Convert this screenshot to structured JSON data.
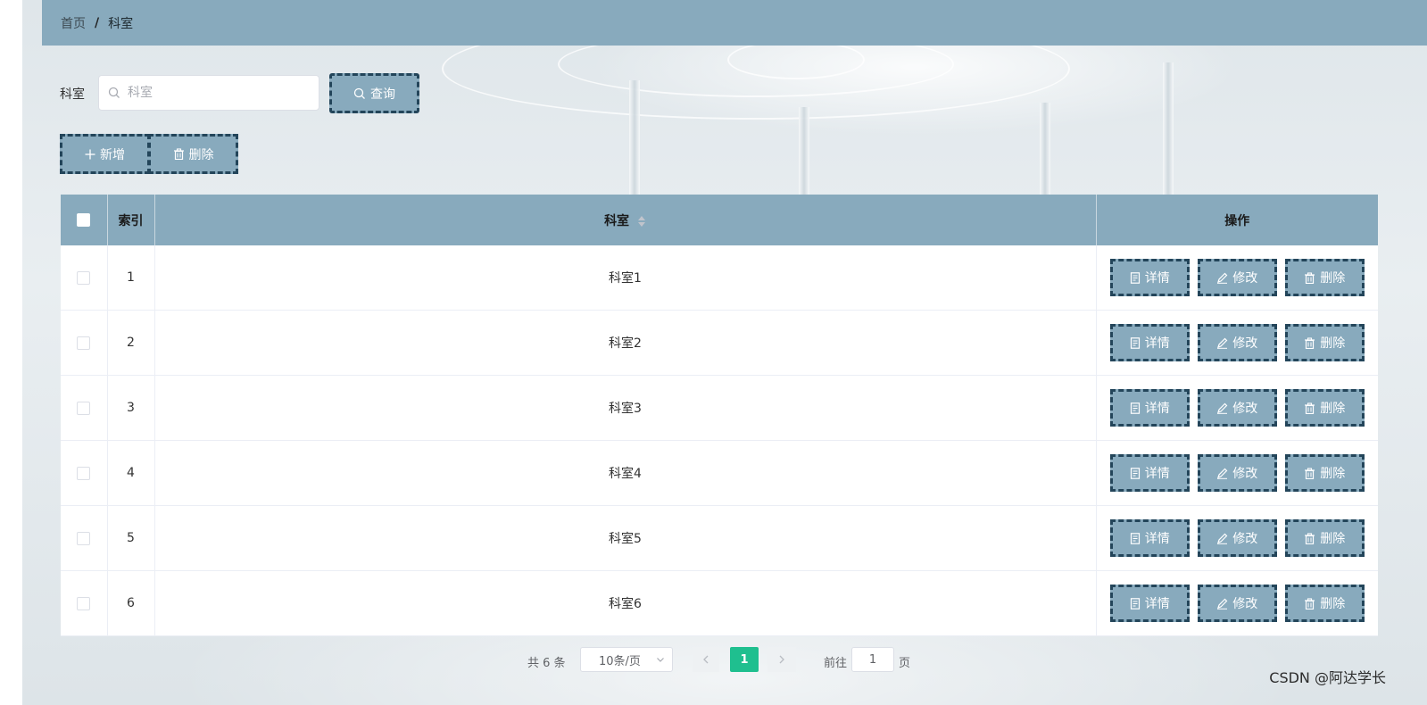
{
  "breadcrumb": {
    "home": "首页",
    "separator": "/",
    "current": "科室"
  },
  "search": {
    "label": "科室",
    "placeholder": "科室",
    "value": "",
    "button": "查询"
  },
  "toolbar": {
    "add": "新增",
    "delete": "删除"
  },
  "table": {
    "columns": {
      "index": "索引",
      "name": "科室",
      "actions": "操作"
    },
    "actions": {
      "detail": "详情",
      "edit": "修改",
      "delete": "删除"
    },
    "rows": [
      {
        "index": "1",
        "name": "科室1"
      },
      {
        "index": "2",
        "name": "科室2"
      },
      {
        "index": "3",
        "name": "科室3"
      },
      {
        "index": "4",
        "name": "科室4"
      },
      {
        "index": "5",
        "name": "科室5"
      },
      {
        "index": "6",
        "name": "科室6"
      }
    ]
  },
  "pagination": {
    "total": "共 6 条",
    "page_size": "10条/页",
    "current_page": "1",
    "goto_label": "前往",
    "goto_value": "1",
    "goto_suffix": "页"
  },
  "watermark": "CSDN @阿达学长",
  "colors": {
    "accent": "#88aabd",
    "dash_border": "#23455a",
    "active_page": "#1fbf8f"
  }
}
